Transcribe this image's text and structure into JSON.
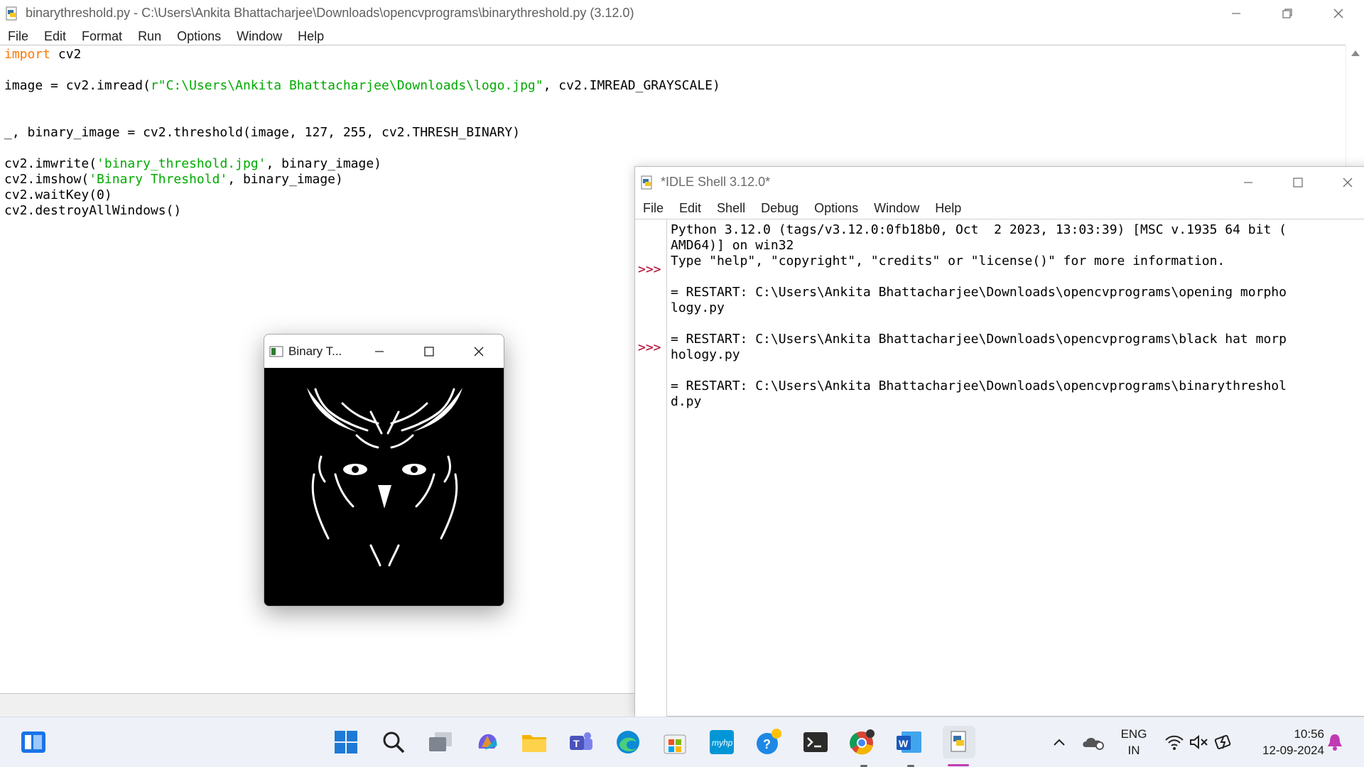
{
  "editor": {
    "title": "binarythreshold.py - C:\\Users\\Ankita Bhattacharjee\\Downloads\\opencvprograms\\binarythreshold.py (3.12.0)",
    "menu": [
      "File",
      "Edit",
      "Format",
      "Run",
      "Options",
      "Window",
      "Help"
    ],
    "code": {
      "l1_kw": "import",
      "l1_rest": " cv2",
      "l3_a": "image = cv2.imread(",
      "l3_str": "r\"C:\\Users\\Ankita Bhattacharjee\\Downloads\\logo.jpg\"",
      "l3_b": ", cv2.IMREAD_GRAYSCALE)",
      "l6": "_, binary_image = cv2.threshold(image, 127, 255, cv2.THRESH_BINARY)",
      "l8_a": "cv2.imwrite(",
      "l8_str": "'binary_threshold.jpg'",
      "l8_b": ", binary_image)",
      "l9_a": "cv2.imshow(",
      "l9_str": "'Binary Threshold'",
      "l9_b": ", binary_image)",
      "l10": "cv2.waitKey(0)",
      "l11": "cv2.destroyAllWindows()"
    }
  },
  "shell": {
    "title": "*IDLE Shell 3.12.0*",
    "menu": [
      "File",
      "Edit",
      "Shell",
      "Debug",
      "Options",
      "Window",
      "Help"
    ],
    "prompt": ">>>",
    "lines": [
      "Python 3.12.0 (tags/v3.12.0:0fb18b0, Oct  2 2023, 13:03:39) [MSC v.1935 64 bit (",
      "AMD64)] on win32",
      "Type \"help\", \"copyright\", \"credits\" or \"license()\" for more information.",
      "",
      "= RESTART: C:\\Users\\Ankita Bhattacharjee\\Downloads\\opencvprograms\\opening morpho",
      "logy.py",
      "",
      "= RESTART: C:\\Users\\Ankita Bhattacharjee\\Downloads\\opencvprograms\\black hat morp",
      "hology.py",
      "",
      "= RESTART: C:\\Users\\Ankita Bhattacharjee\\Downloads\\opencvprograms\\binarythreshol",
      "d.py"
    ]
  },
  "image_window": {
    "title": "Binary T..."
  },
  "taskbar": {
    "lang": "ENG",
    "region": "IN",
    "time": "10:56",
    "date": "12-09-2024"
  }
}
